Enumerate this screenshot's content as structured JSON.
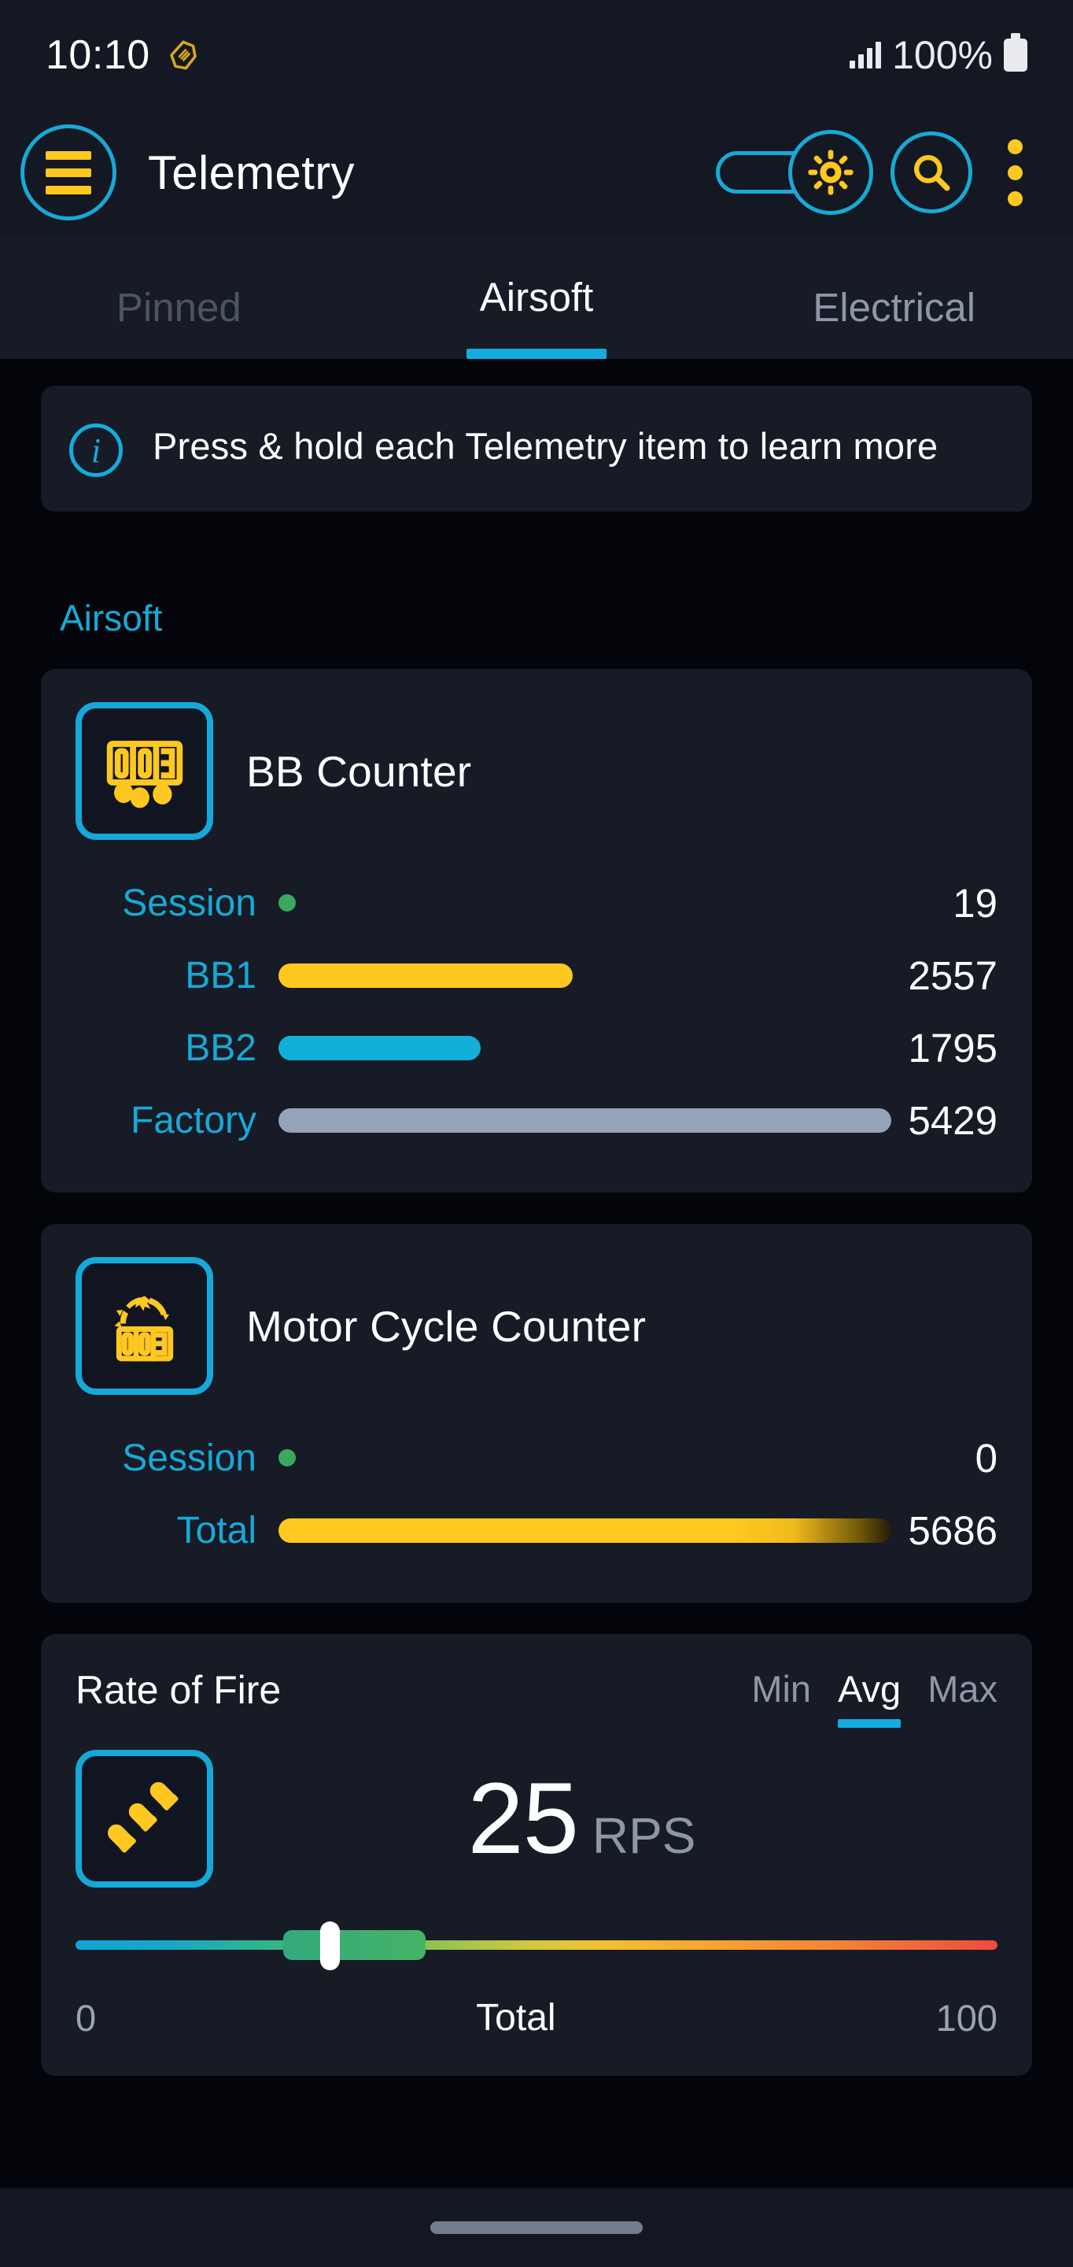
{
  "status_bar": {
    "clock": "10:10",
    "nfc_icon": "nfc-badge-icon",
    "signal_icon": "signal-bars-icon",
    "battery_percent": "100%",
    "battery_icon": "battery-full-icon"
  },
  "app_bar": {
    "menu_icon": "hamburger-menu-icon",
    "title": "Telemetry",
    "settings_toggle_icon": "settings-gear-toggle-icon",
    "search_icon": "search-icon",
    "overflow_icon": "overflow-menu-icon"
  },
  "tabs": {
    "items": [
      {
        "label": "Pinned",
        "state": "inactive"
      },
      {
        "label": "Airsoft",
        "state": "active"
      },
      {
        "label": "Electrical",
        "state": "inactive"
      }
    ]
  },
  "banner": {
    "icon": "info-circle-icon",
    "text": "Press & hold each Telemetry item to learn more"
  },
  "section": {
    "title": "Airsoft"
  },
  "cards": {
    "bb_counter": {
      "icon": "seven-segment-bb-counter-icon",
      "title": "BB Counter",
      "rows": [
        {
          "label": "Session",
          "value": "19",
          "type": "dot",
          "dot_color": "#3aa85e"
        },
        {
          "label": "BB1",
          "value": "2557",
          "type": "bar",
          "bar_color": "#ffc820",
          "bar_pct": 48
        },
        {
          "label": "BB2",
          "value": "1795",
          "type": "bar",
          "bar_color": "#12b0d8",
          "bar_pct": 33
        },
        {
          "label": "Factory",
          "value": "5429",
          "type": "bar",
          "bar_color": "#94a3b8",
          "bar_pct": 100
        }
      ]
    },
    "motor_cycle_counter": {
      "icon": "motor-cycle-counter-icon",
      "title": "Motor Cycle Counter",
      "rows": [
        {
          "label": "Session",
          "value": "0",
          "type": "dot",
          "dot_color": "#3aa85e"
        },
        {
          "label": "Total",
          "value": "5686",
          "type": "bar",
          "bar_color": "#ffc820",
          "bar_pct": 100
        }
      ]
    },
    "rate_of_fire": {
      "icon": "bullets-diagonal-icon",
      "title": "Rate of Fire",
      "segments": [
        {
          "label": "Min",
          "state": "inactive"
        },
        {
          "label": "Avg",
          "state": "active"
        },
        {
          "label": "Max",
          "state": "inactive"
        }
      ],
      "value": "25",
      "unit": "RPS",
      "slider": {
        "min_label": "0",
        "mid_label": "Total",
        "max_label": "100",
        "value_pct": 25
      }
    }
  },
  "nav_bar": {
    "home_pill": "home-gesture-pill"
  },
  "colors": {
    "accent_cyan": "#18a9d6",
    "accent_yellow": "#ffc820",
    "page_bg": "#04050a",
    "card_bg": "#161b26",
    "bar_bg": "#141823",
    "status_green": "#3aa85e",
    "muted_text": "#8d97a8"
  }
}
